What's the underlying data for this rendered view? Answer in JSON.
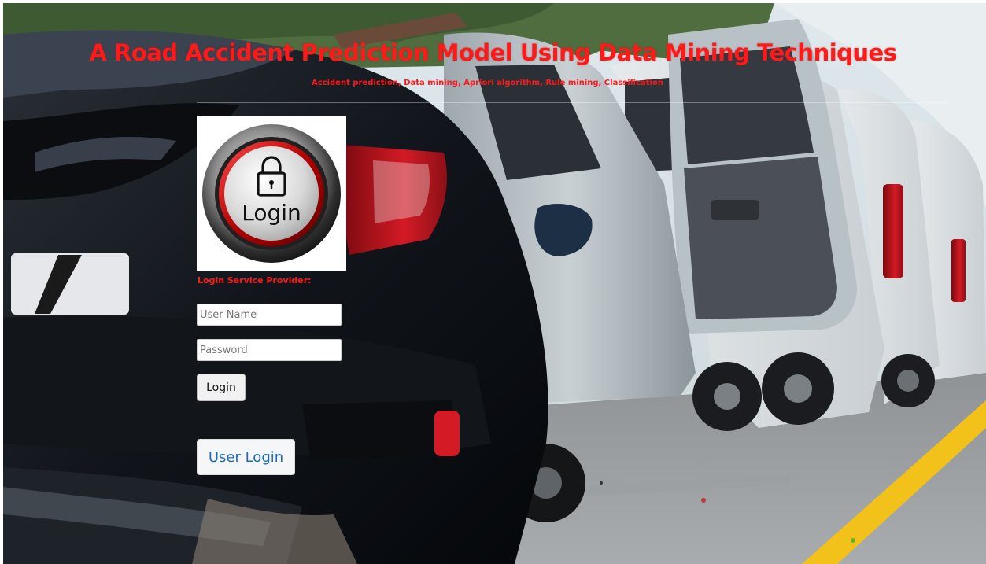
{
  "header": {
    "title": "A Road Accident Prediction Model Using Data Mining Techniques",
    "subtitle": "Accident prediction, Data mining, Apriori algorithm, Rule mining, Classification"
  },
  "login_logo": {
    "icon": "padlock-icon",
    "text": "Login"
  },
  "login_form": {
    "section_label": "Login Service Provider:",
    "username_placeholder": "User Name",
    "password_placeholder": "Password",
    "login_button": "Login"
  },
  "user_login_button": "User Login",
  "colors": {
    "title_red": "#ff1a1a",
    "link_blue": "#1e6bbf",
    "road_yellow": "#f2c21a"
  }
}
